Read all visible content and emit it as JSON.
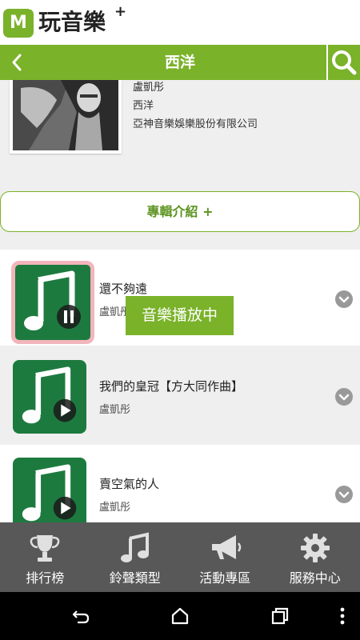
{
  "app": {
    "logo_letter": "M",
    "logo_plus": "+",
    "name": "玩音樂",
    "name_plus": "+"
  },
  "title_bar": {
    "title": "西洋",
    "back_icon": "chevron-left-icon",
    "search_icon": "search-icon"
  },
  "album": {
    "artist": "盧凱彤",
    "genre": "西洋",
    "label": "亞神音樂娛樂股份有限公司",
    "intro_button": "專輯介紹 +"
  },
  "songs": [
    {
      "title": "還不夠遠",
      "artist": "盧凱彤",
      "state": "playing"
    },
    {
      "title": "我們的皇冠【方大同作曲】",
      "artist": "盧凱彤",
      "state": "paused"
    },
    {
      "title": "賣空氣的人",
      "artist": "盧凱彤",
      "state": "paused"
    }
  ],
  "toast": "音樂播放中",
  "bottom_nav": [
    {
      "label": "排行榜",
      "icon": "trophy-icon"
    },
    {
      "label": "鈴聲類型",
      "icon": "music-note-icon"
    },
    {
      "label": "活動專區",
      "icon": "megaphone-icon"
    },
    {
      "label": "服務中心",
      "icon": "gear-icon"
    }
  ],
  "colors": {
    "accent": "#7ab22a",
    "song_tile": "#1d7a3f",
    "nav_bg": "#585858",
    "playing_border": "#f2b5bc"
  }
}
